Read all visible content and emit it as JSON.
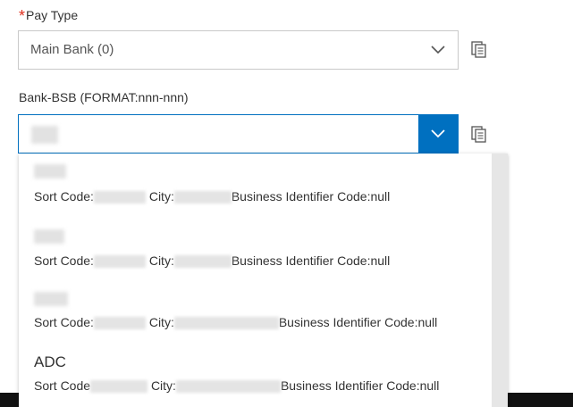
{
  "pay_type": {
    "label": "Pay Type",
    "required_mark": "*",
    "value": "Main Bank (0)"
  },
  "bank_bsb": {
    "label": "Bank-BSB (FORMAT:nnn-nnn)",
    "value": ""
  },
  "dropdown": {
    "options": [
      {
        "title": "",
        "sort_label": "Sort Code:",
        "city_label": "City:",
        "bic_label": "Business Identifier Code:null"
      },
      {
        "title": "",
        "sort_label": "Sort Code:",
        "city_label": "City:",
        "bic_label": "Business Identifier Code:null"
      },
      {
        "title": "",
        "sort_label": "Sort Code:",
        "city_label": "City:",
        "bic_label": "Business Identifier Code:null"
      },
      {
        "title": "ADC",
        "sort_label": "Sort Code",
        "city_label": "City:",
        "bic_label": "Business Identifier Code:null"
      }
    ]
  },
  "colors": {
    "accent": "#0070c0",
    "required": "#e0301e"
  },
  "icons": [
    "chevron-down-icon",
    "copy-icon"
  ]
}
